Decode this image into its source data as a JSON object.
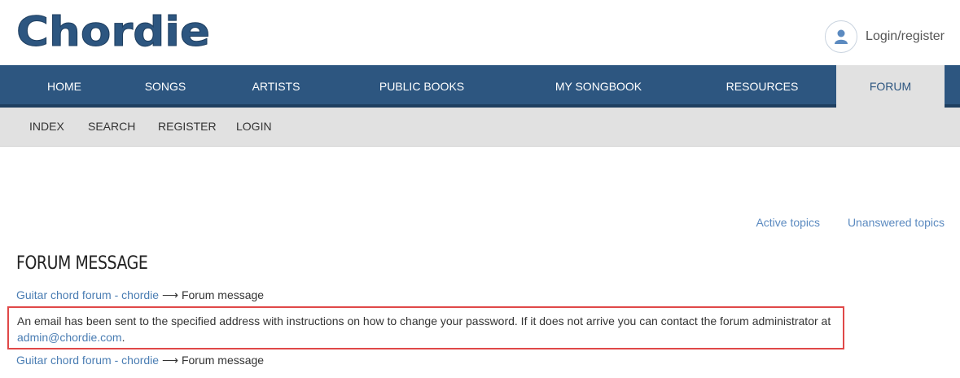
{
  "brand": {
    "name": "Chordie",
    "logo_text": "Chordie",
    "primary_color": "#2d5680"
  },
  "header": {
    "login_label": "Login/register",
    "avatar_icon": "user-icon"
  },
  "main_nav": {
    "items": [
      {
        "label": "HOME",
        "active": false
      },
      {
        "label": "SONGS",
        "active": false
      },
      {
        "label": "ARTISTS",
        "active": false
      },
      {
        "label": "PUBLIC BOOKS",
        "active": false
      },
      {
        "label": "MY SONGBOOK",
        "active": false
      },
      {
        "label": "RESOURCES",
        "active": false
      },
      {
        "label": "FORUM",
        "active": true
      }
    ]
  },
  "sub_nav": {
    "items": [
      {
        "label": "INDEX"
      },
      {
        "label": "SEARCH"
      },
      {
        "label": "REGISTER"
      },
      {
        "label": "LOGIN"
      }
    ]
  },
  "top_links": {
    "active_topics": "Active topics",
    "unanswered_topics": "Unanswered topics"
  },
  "page": {
    "title": "FORUM MESSAGE",
    "breadcrumb": {
      "link": "Guitar chord forum - chordie",
      "separator": "⟶",
      "current": "Forum message"
    },
    "message_text": "An email has been sent to the specified address with instructions on how to change your password. If it does not arrive you can contact the forum administrator at",
    "message_email": "admin@chordie.com",
    "message_end": "."
  }
}
